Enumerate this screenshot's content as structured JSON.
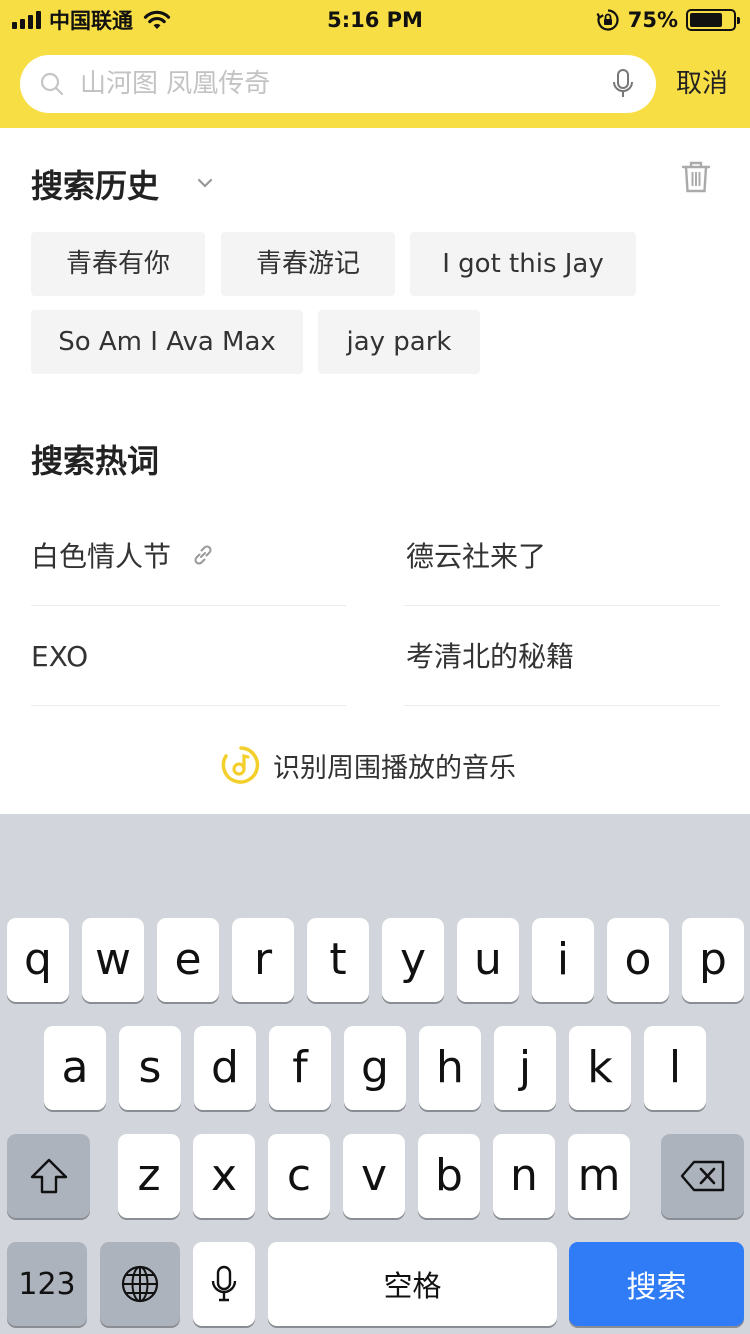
{
  "status_bar": {
    "carrier": "中国联通",
    "time": "5:16 PM",
    "battery_percent": "75%",
    "battery_level": 0.75,
    "icons": [
      "signal-icon",
      "wifi-icon",
      "orientation-lock-icon",
      "battery-icon"
    ]
  },
  "search": {
    "placeholder": "山河图 凤凰传奇",
    "value": "",
    "cancel_label": "取消"
  },
  "history": {
    "title": "搜索历史",
    "items": [
      "青春有你",
      "青春游记",
      "I got this Jay",
      "So Am I Ava Max",
      "jay park"
    ]
  },
  "hot": {
    "title": "搜索热词",
    "items": [
      "白色情人节",
      "德云社来了",
      "EXO",
      "考清北的秘籍"
    ]
  },
  "recognize": {
    "label": "识别周围播放的音乐"
  },
  "keyboard": {
    "row1": [
      "q",
      "w",
      "e",
      "r",
      "t",
      "y",
      "u",
      "i",
      "o",
      "p"
    ],
    "row2": [
      "a",
      "s",
      "d",
      "f",
      "g",
      "h",
      "j",
      "k",
      "l"
    ],
    "row3": [
      "z",
      "x",
      "c",
      "v",
      "b",
      "n",
      "m"
    ],
    "numbers_label": "123",
    "space_label": "空格",
    "search_label": "搜索"
  },
  "colors": {
    "header": "#f8de45",
    "accent_yellow": "#f3cf2b",
    "keyboard_bg": "#d2d5db",
    "search_key": "#2f7cf6"
  }
}
